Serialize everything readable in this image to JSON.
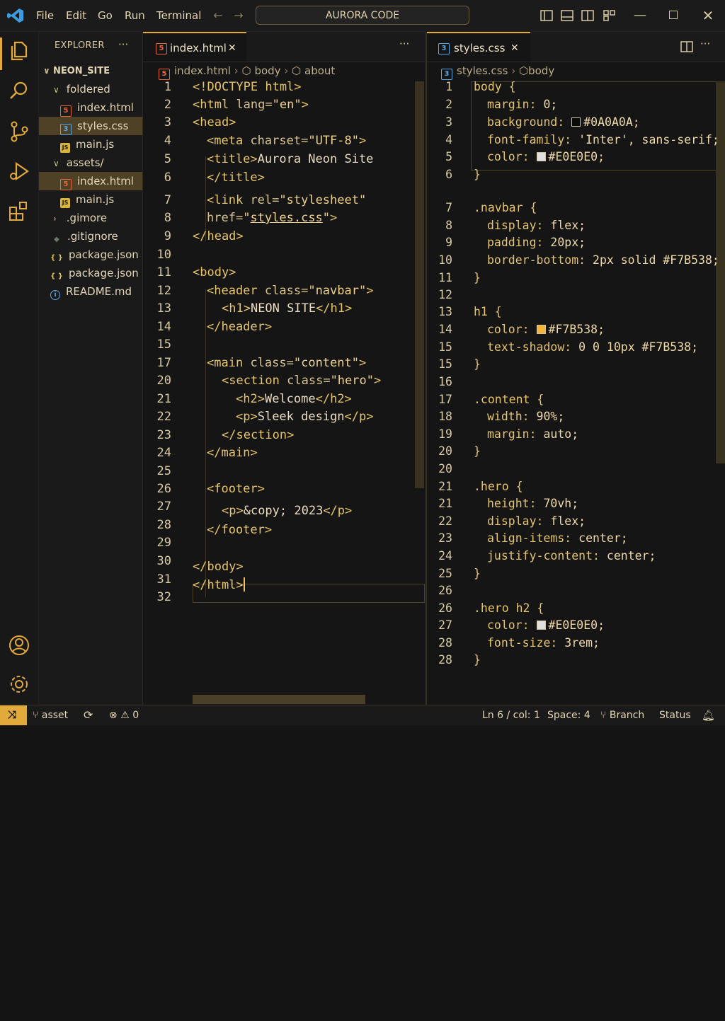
{
  "title_bar": {
    "menu": [
      "File",
      "Edit",
      "Go",
      "Run",
      "Terminal"
    ],
    "search": "AURORA CODE"
  },
  "explorer": {
    "title": "EXPLORER",
    "more": "···",
    "root": "NEON_SITE",
    "items": [
      {
        "label": "foldered",
        "type": "folder"
      },
      {
        "label": "index.html",
        "type": "html"
      },
      {
        "label": "styles.css",
        "type": "css"
      },
      {
        "label": "main.js",
        "type": "js"
      },
      {
        "label": "assets/",
        "type": "folder"
      },
      {
        "label": "index.html",
        "type": "html"
      },
      {
        "label": "main.js",
        "type": "js"
      },
      {
        "label": ".gimore",
        "type": "folder-closed"
      },
      {
        "label": ".gitignore",
        "type": "git"
      },
      {
        "label": "package.json",
        "type": "json"
      },
      {
        "label": "package.json",
        "type": "json"
      },
      {
        "label": "README.md",
        "type": "info"
      }
    ]
  },
  "left_editor": {
    "tab": "index.html",
    "breadcrumbs": [
      "index.html",
      "body",
      "about"
    ],
    "more": "···",
    "line_numbers": [
      "1",
      "2",
      "3",
      "4",
      "5",
      "6",
      "7",
      "8",
      "9",
      "10",
      "11",
      "12",
      "13",
      "14",
      "15",
      "17",
      "20",
      "21",
      "22",
      "23",
      "24",
      "25",
      "26",
      "27",
      "28",
      "29",
      "30",
      "31",
      "32"
    ]
  },
  "right_editor": {
    "tab": "styles.css",
    "breadcrumbs": [
      "styles.css",
      "body"
    ],
    "more": "···",
    "line_numbers": [
      "1",
      "2",
      "3",
      "4",
      "5",
      "6",
      "7",
      "8",
      "9",
      "10",
      "11",
      "12",
      "13",
      "14",
      "15",
      "15",
      "16",
      "17",
      "18",
      "19",
      "20",
      "20",
      "21",
      "21",
      "22",
      "23",
      "24",
      "25",
      "26",
      "26",
      "27",
      "28",
      "28"
    ]
  },
  "status_bar": {
    "branch": "asset",
    "problems": "0",
    "position": "Ln 6 / col: 1",
    "spaces": "Space: 4",
    "branch_label": "Branch",
    "status": "Status"
  },
  "colors": {
    "accent": "#E2A93B",
    "bg": "#151515",
    "swatch_dark": "#0A0A0A",
    "swatch_light": "#E0E0E0",
    "swatch_amber": "#F7B538"
  }
}
